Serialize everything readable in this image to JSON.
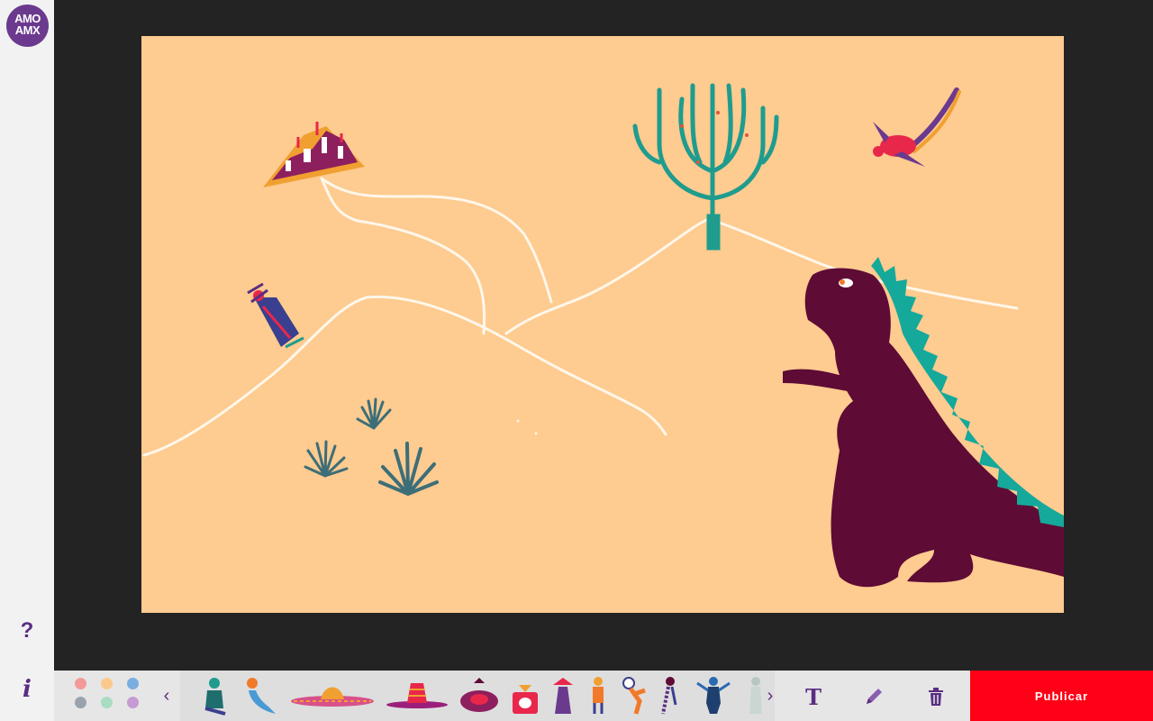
{
  "app": {
    "logo_line1": "AMO",
    "logo_line2": "AMX",
    "help_label": "?",
    "info_label": "i"
  },
  "colors": {
    "canvas_bg": "#fecb90",
    "accent": "#5a2d82",
    "publish_bg": "#ff0016",
    "line_white": "#fff7ea"
  },
  "palette": [
    {
      "name": "red",
      "color": "#f49a9a"
    },
    {
      "name": "peach",
      "color": "#fbc98e"
    },
    {
      "name": "blue",
      "color": "#79aee0"
    },
    {
      "name": "gray",
      "color": "#9aa3ad"
    },
    {
      "name": "mint",
      "color": "#a9dcc0"
    },
    {
      "name": "lilac",
      "color": "#c79ad4"
    }
  ],
  "sticker_tray": {
    "prev_label": "‹",
    "next_label": "›",
    "stickers": [
      "sitting-person",
      "mermaid",
      "sombrero-wide",
      "sombrero-purple",
      "sombrero-top-view",
      "hat-witch",
      "scale-red",
      "lantern-purple",
      "astronaut-small",
      "astronaut-floating",
      "braided-woman",
      "luchador-blue",
      "ghost-figure"
    ]
  },
  "tools": {
    "text_label": "T",
    "text_icon": "text-tool-icon",
    "pencil_icon": "pencil-icon",
    "trash_icon": "trash-icon"
  },
  "publish_label": "Publicar"
}
